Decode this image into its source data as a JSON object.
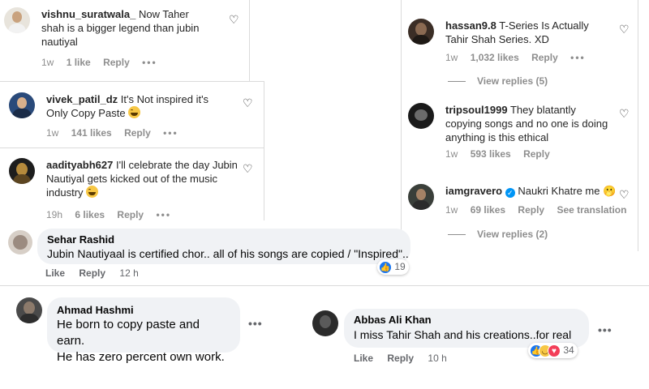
{
  "instagram": {
    "comments": [
      {
        "username": "vishnu_suratwala_",
        "text": "Now Taher shah is a bigger legend than jubin nautiyal",
        "time": "1w",
        "likes": "1 like",
        "reply": "Reply"
      },
      {
        "username": "vivek_patil_dz",
        "text": "It's Not inspired it's Only Copy Paste",
        "time": "1w",
        "likes": "141 likes",
        "reply": "Reply"
      },
      {
        "username": "aadityabh627",
        "text": "I'll celebrate the day Jubin Nautiyal gets kicked out of the music industry",
        "time": "19h",
        "likes": "6 likes",
        "reply": "Reply"
      },
      {
        "username": "hassan9.8",
        "text": "T-Series Is Actually Tahir Shah Series. XD",
        "time": "1w",
        "likes": "1,032 likes",
        "reply": "Reply",
        "view_replies": "View replies (5)"
      },
      {
        "username": "tripsoul1999",
        "text": "They blatantly copying songs and no one is doing anything is this ethical",
        "time": "1w",
        "likes": "593 likes",
        "reply": "Reply"
      },
      {
        "username": "iamgravero",
        "text": "Naukri Khatre me 🫢",
        "time": "1w",
        "likes": "69 likes",
        "reply": "Reply",
        "translation": "See translation",
        "view_replies": "View replies (2)"
      }
    ]
  },
  "facebook": {
    "comments": [
      {
        "name": "Sehar Rashid",
        "text": "Jubin Nautiyaal is certified chor.. all of his songs are copied / \"Inspired\"..",
        "like": "Like",
        "reply": "Reply",
        "time": "12 h",
        "reactions": "19"
      },
      {
        "name": "Ahmad Hashmi",
        "line1": "He born to copy paste and earn.",
        "line2": "He has zero percent own work."
      },
      {
        "name": "Abbas Ali Khan",
        "text": "I miss Tahir Shah and his creations..for real",
        "like": "Like",
        "reply": "Reply",
        "time": "10 h",
        "reactions": "34"
      }
    ]
  },
  "colors": {
    "like_blue": "#1877f2",
    "haha_yellow": "#f7c744",
    "love_red": "#f33e58",
    "verified_blue": "#0095f6"
  }
}
